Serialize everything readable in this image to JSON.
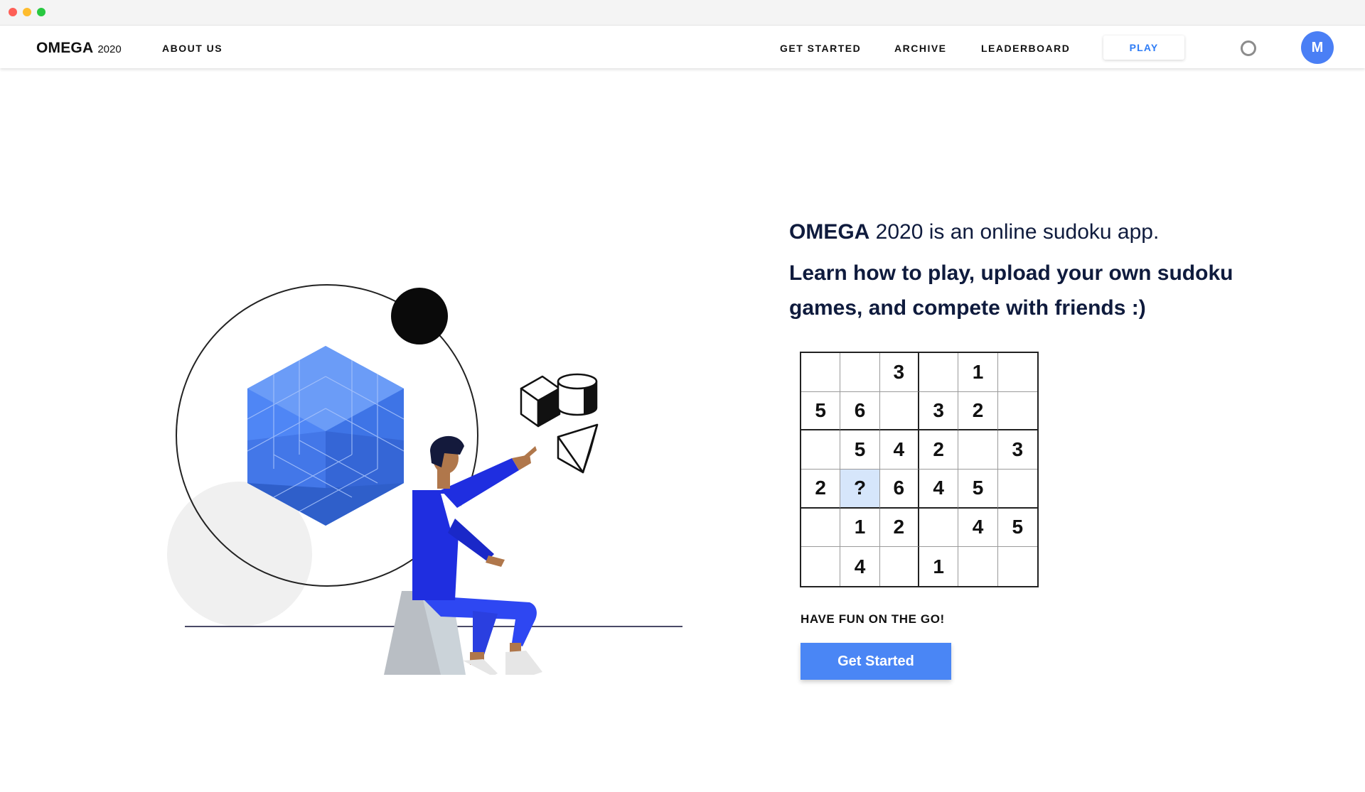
{
  "nav": {
    "brand_name": "OMEGA",
    "brand_year": "2020",
    "about": "ABOUT US",
    "get_started": "GET STARTED",
    "archive": "ARCHIVE",
    "leaderboard": "LEADERBOARD",
    "play": "PLAY",
    "avatar_initial": "M",
    "status_icon": "ring-icon"
  },
  "hero": {
    "brand": "OMEGA",
    "line1_rest": " 2020 is an online sudoku app.",
    "subtitle": "Learn how to play, upload your own sudoku games, and compete with friends :)"
  },
  "sudoku": {
    "highlight_color": "#d6e6fb",
    "rows": [
      [
        "",
        "",
        "3",
        "",
        "1",
        ""
      ],
      [
        "5",
        "6",
        "",
        "3",
        "2",
        ""
      ],
      [
        "",
        "5",
        "4",
        "2",
        "",
        "3"
      ],
      [
        "2",
        "?",
        "6",
        "4",
        "5",
        ""
      ],
      [
        "",
        "1",
        "2",
        "",
        "4",
        "5"
      ],
      [
        "",
        "4",
        "",
        "1",
        "",
        ""
      ]
    ],
    "highlighted": [
      3,
      1
    ]
  },
  "tagline": "HAVE FUN ON THE GO!",
  "cta_label": "Get Started",
  "colors": {
    "accent": "#4a86f5",
    "play_text": "#2f7df6",
    "heading": "#0f1b3d"
  }
}
